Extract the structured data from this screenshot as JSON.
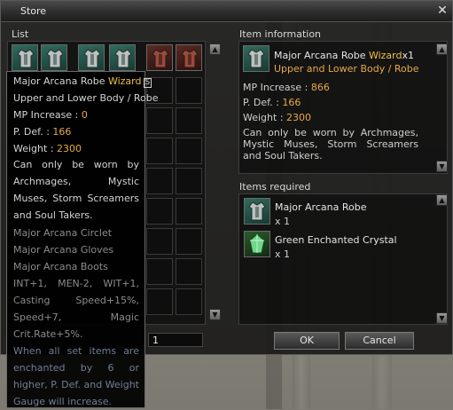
{
  "window": {
    "title": "Store",
    "close_glyph": "✕"
  },
  "list": {
    "label": "List",
    "quantity_value": "1"
  },
  "info": {
    "label": "Item information",
    "item_name": "Major Arcana Robe",
    "grade": "Wizard",
    "count": "x1",
    "slot": "Upper and Lower Body / Robe",
    "mp_label": "MP Increase : ",
    "mp_value": "866",
    "pdef_label": "P. Def. : ",
    "pdef_value": "166",
    "weight_label": "Weight : ",
    "weight_value": "2300",
    "description": "Can only be worn by Archmages, Mystic Muses, Storm Screamers and Soul Takers."
  },
  "required": {
    "label": "Items required",
    "items": [
      {
        "name": "Major Arcana Robe",
        "qty": "x 1",
        "icon": "robe-icon"
      },
      {
        "name": "Green Enchanted Crystal",
        "qty": "x 1",
        "icon": "crystal-icon"
      }
    ]
  },
  "buttons": {
    "ok": "OK",
    "cancel": "Cancel"
  },
  "tooltip": {
    "name": "Major Arcana Robe",
    "grade": "Wizard",
    "badge": "S",
    "slot": "Upper and Lower Body / Robe",
    "mp_label": "MP Increase : ",
    "mp_value": "0",
    "pdef_label": "P. Def. : ",
    "pdef_value": "166",
    "weight_label": "Weight : ",
    "weight_value": "2300",
    "description": "Can only be worn by Archmages, Mystic Muses, Storm Screamers and Soul Takers.",
    "set_items": [
      "Major Arcana Circlet",
      "Major Arcana Gloves",
      "Major Arcana Boots"
    ],
    "set_bonus": "INT+1, MEN-2, WIT+1, Casting Speed+15%, Speed+7, Magic Crit.Rate+5%.",
    "enchant_effect": "When all set items are enchanted by 6 or higher, P. Def. and Weight Gauge will increase."
  },
  "colors": {
    "accent_orange": "#e8a848",
    "grade_gold": "#f0c040",
    "panel_bg": "#161616"
  }
}
